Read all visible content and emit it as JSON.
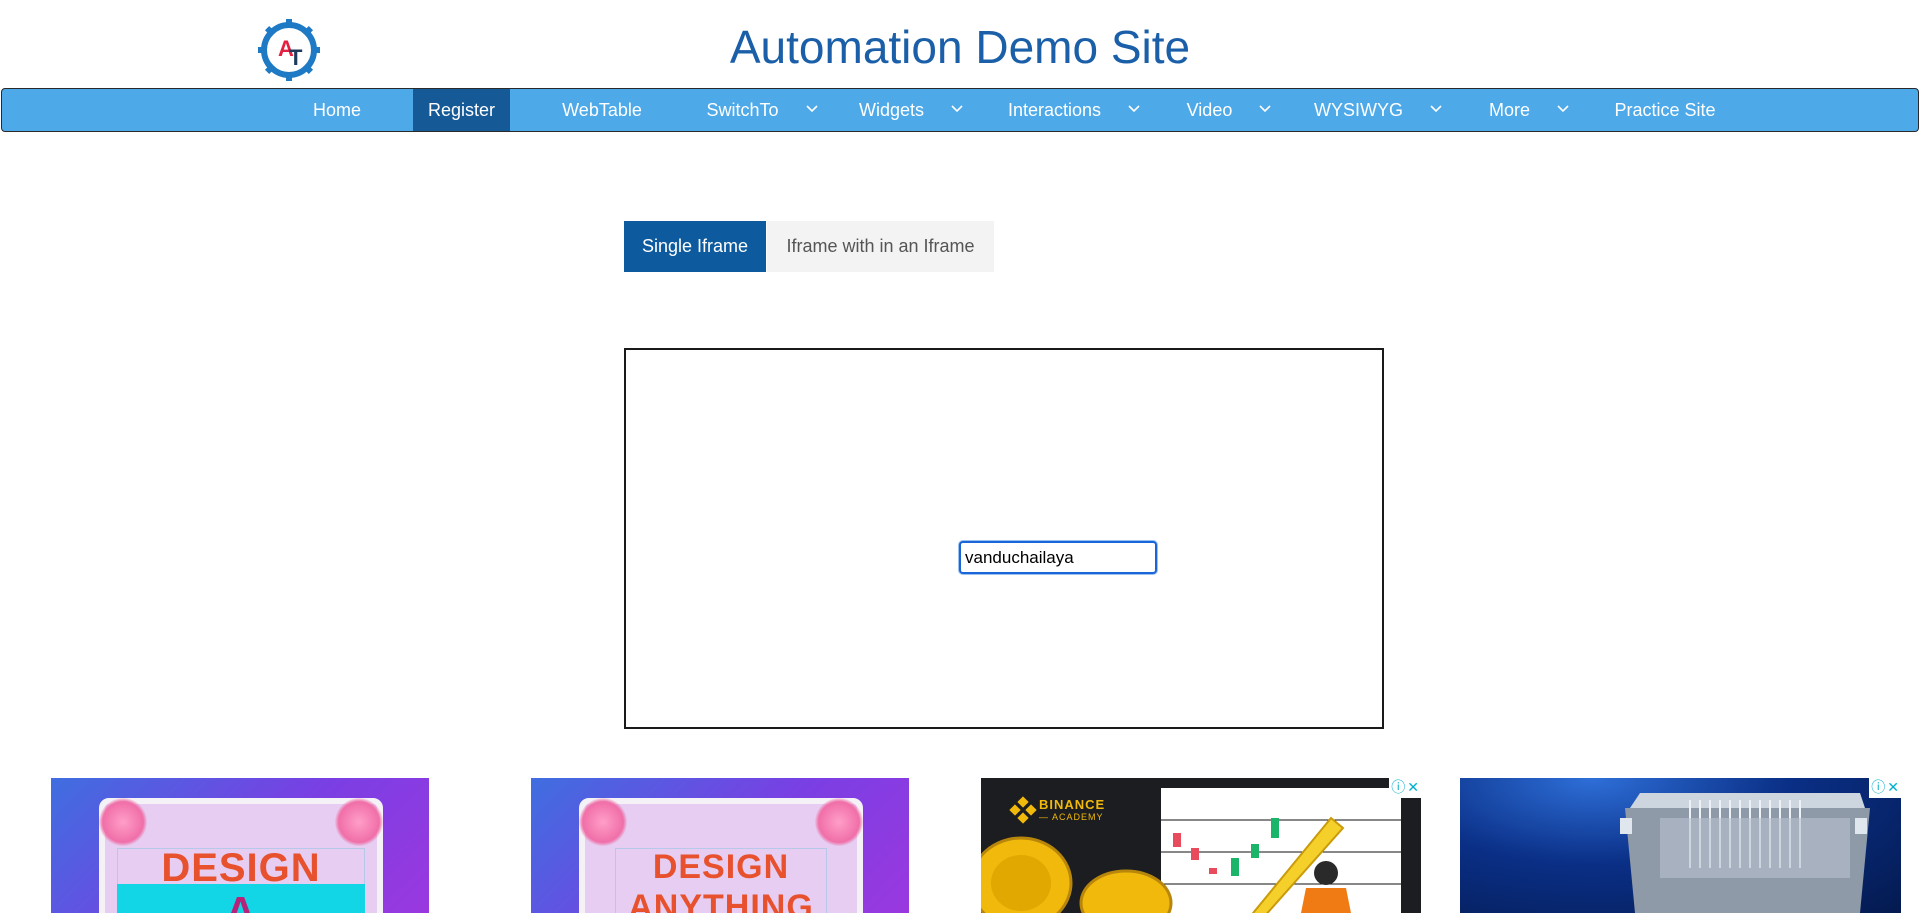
{
  "header": {
    "title": "Automation Demo Site",
    "logo_letters": "AT"
  },
  "nav": {
    "items": [
      {
        "label": "Home"
      },
      {
        "label": "Register"
      },
      {
        "label": "WebTable"
      },
      {
        "label": "SwitchTo"
      },
      {
        "label": "Widgets"
      },
      {
        "label": "Interactions"
      },
      {
        "label": "Video"
      },
      {
        "label": "WYSIWYG"
      },
      {
        "label": "More"
      },
      {
        "label": "Practice Site"
      }
    ],
    "active_item": "Register"
  },
  "tabs": {
    "single": "Single Iframe",
    "nested": "Iframe with in an Iframe",
    "active_tab": "Single Iframe"
  },
  "iframe": {
    "input_value": "vanduchailaya"
  },
  "ads": {
    "design1_line1": "DESIGN",
    "design1_line2": "A",
    "design2_line1": "DESIGN",
    "design2_line2": "ANYTHING",
    "binance_brand": "BINANCE",
    "binance_sub": "— ACADEMY"
  },
  "colors": {
    "nav_bg": "#4ea9e8",
    "nav_active": "#155a96",
    "title": "#1a5fa8",
    "tab_active": "#0d5b9e"
  }
}
